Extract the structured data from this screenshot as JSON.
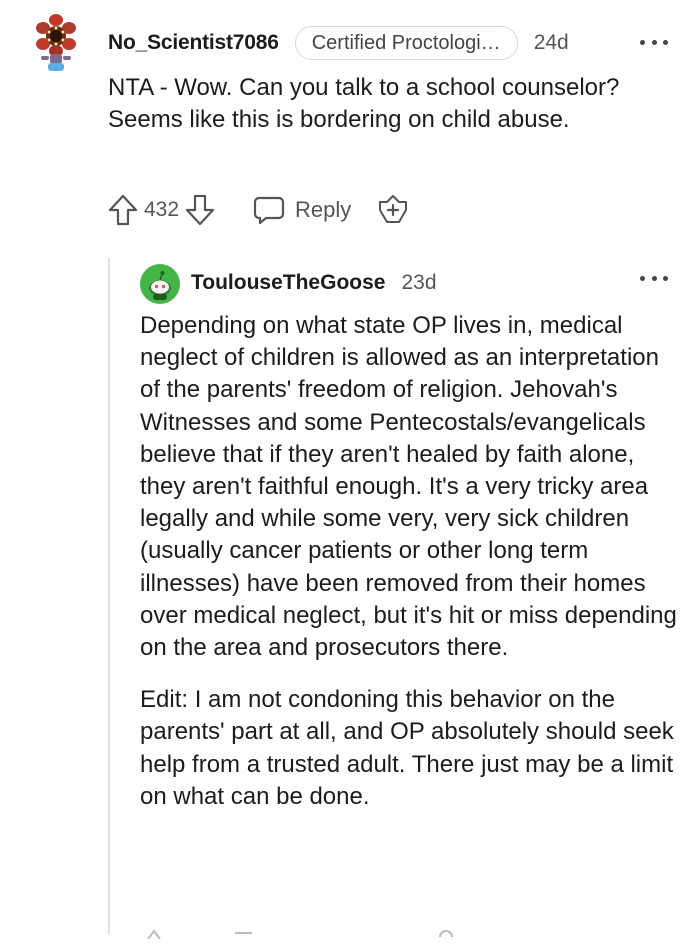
{
  "comment": {
    "author": "No_Scientist7086",
    "flair": "Certified Proctologi…",
    "age": "24d",
    "body": "NTA - Wow. Can you talk to a school counselor? Seems like this is bordering on child abuse.",
    "score": "432",
    "reply_label": "Reply",
    "avatar_icon": "demogorgon-avatar-icon"
  },
  "reply": {
    "author": "ToulouseTheGoose",
    "age": "23d",
    "avatar_icon": "snoo-avatar-icon",
    "paragraphs": [
      "Depending on what state OP lives in, medical neglect of children is allowed as an interpretation of the parents' freedom of religion. Jehovah's Witnesses and some Pentecostals/evangelicals believe that if they aren't healed by faith alone, they aren't faithful enough. It's a very tricky area legally and while some very, very sick children (usually cancer patients or other long term illnesses) have been removed from their homes over medical neglect, but it's hit or miss depending on the area and prosecutors there.",
      "Edit: I am not condoning this behavior on the parents' part at all, and OP absolutely should seek help from a trusted adult. There just may be a limit on what can be done."
    ]
  },
  "colors": {
    "text": "#1c1c1c",
    "muted": "#555555",
    "border": "#d7d7d7",
    "thread": "#e2e2e2",
    "snoo_green": "#46b549"
  }
}
